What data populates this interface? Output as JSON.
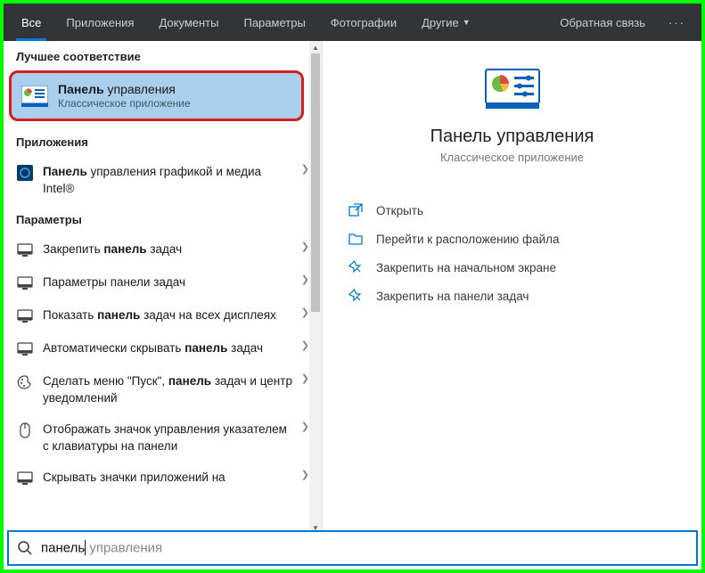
{
  "topbar": {
    "tabs": [
      {
        "label": "Все",
        "active": true
      },
      {
        "label": "Приложения"
      },
      {
        "label": "Документы"
      },
      {
        "label": "Параметры"
      },
      {
        "label": "Фотографии"
      },
      {
        "label": "Другие",
        "dropdown": true
      }
    ],
    "feedback": "Обратная связь",
    "more": "···"
  },
  "left": {
    "best_header": "Лучшее соответствие",
    "best": {
      "title_bold": "Панель",
      "title_rest": " управления",
      "subtitle": "Классическое приложение"
    },
    "apps_header": "Приложения",
    "apps": [
      {
        "pre": "",
        "bold": "Панель",
        "post": " управления графикой и медиа Intel®",
        "icon": "intel"
      }
    ],
    "settings_header": "Параметры",
    "settings": [
      {
        "pre": "Закрепить ",
        "bold": "панель",
        "post": " задач",
        "icon": "monitor"
      },
      {
        "pre": "Параметры панели задач",
        "bold": "",
        "post": "",
        "icon": "monitor"
      },
      {
        "pre": "Показать ",
        "bold": "панель",
        "post": " задач на всех дисплеях",
        "icon": "monitor"
      },
      {
        "pre": "Автоматически скрывать ",
        "bold": "панель",
        "post": " задач",
        "icon": "monitor"
      },
      {
        "pre": "Сделать меню \"Пуск\", ",
        "bold": "панель",
        "post": " задач и центр уведомлений",
        "icon": "palette"
      },
      {
        "pre": "Отображать значок управления указателем с клавиатуры на панели",
        "bold": "",
        "post": "",
        "icon": "mouse"
      },
      {
        "pre": "Скрывать значки приложений на",
        "bold": "",
        "post": "",
        "icon": "monitor"
      }
    ]
  },
  "right": {
    "title": "Панель управления",
    "subtitle": "Классическое приложение",
    "actions": [
      {
        "label": "Открыть",
        "icon": "open"
      },
      {
        "label": "Перейти к расположению файла",
        "icon": "folder"
      },
      {
        "label": "Закрепить на начальном экране",
        "icon": "pin"
      },
      {
        "label": "Закрепить на панели задач",
        "icon": "pin"
      }
    ]
  },
  "search": {
    "typed": "панель",
    "suggestion": " управления"
  }
}
